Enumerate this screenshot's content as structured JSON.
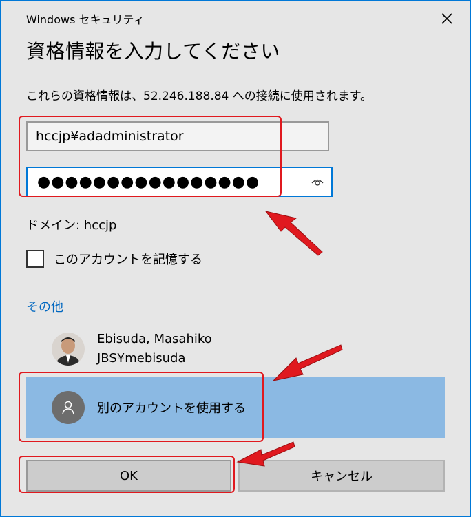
{
  "window": {
    "title": "Windows セキュリティ",
    "heading": "資格情報を入力してください",
    "description": "これらの資格情報は、52.246.188.84 への接続に使用されます。"
  },
  "form": {
    "username": "hccjp¥adadministrator",
    "password_mask": "●●●●●●●●●●●●●●●●",
    "domain": "ドメイン: hccjp",
    "remember_label": "このアカウントを記憶する",
    "remember_checked": false
  },
  "other": {
    "link_label": "その他",
    "account_name": "Ebisuda, Masahiko",
    "account_user": "JBS¥mebisuda",
    "use_other_label": "別のアカウントを使用する"
  },
  "buttons": {
    "ok": "OK",
    "cancel": "キャンセル"
  },
  "icons": [
    "close-icon",
    "reveal-password-icon",
    "user-silhouette-icon"
  ],
  "colors": {
    "accent": "#0078d7",
    "link": "#0067c0",
    "selection": "#8bb9e3",
    "annotation": "#e0191f"
  }
}
